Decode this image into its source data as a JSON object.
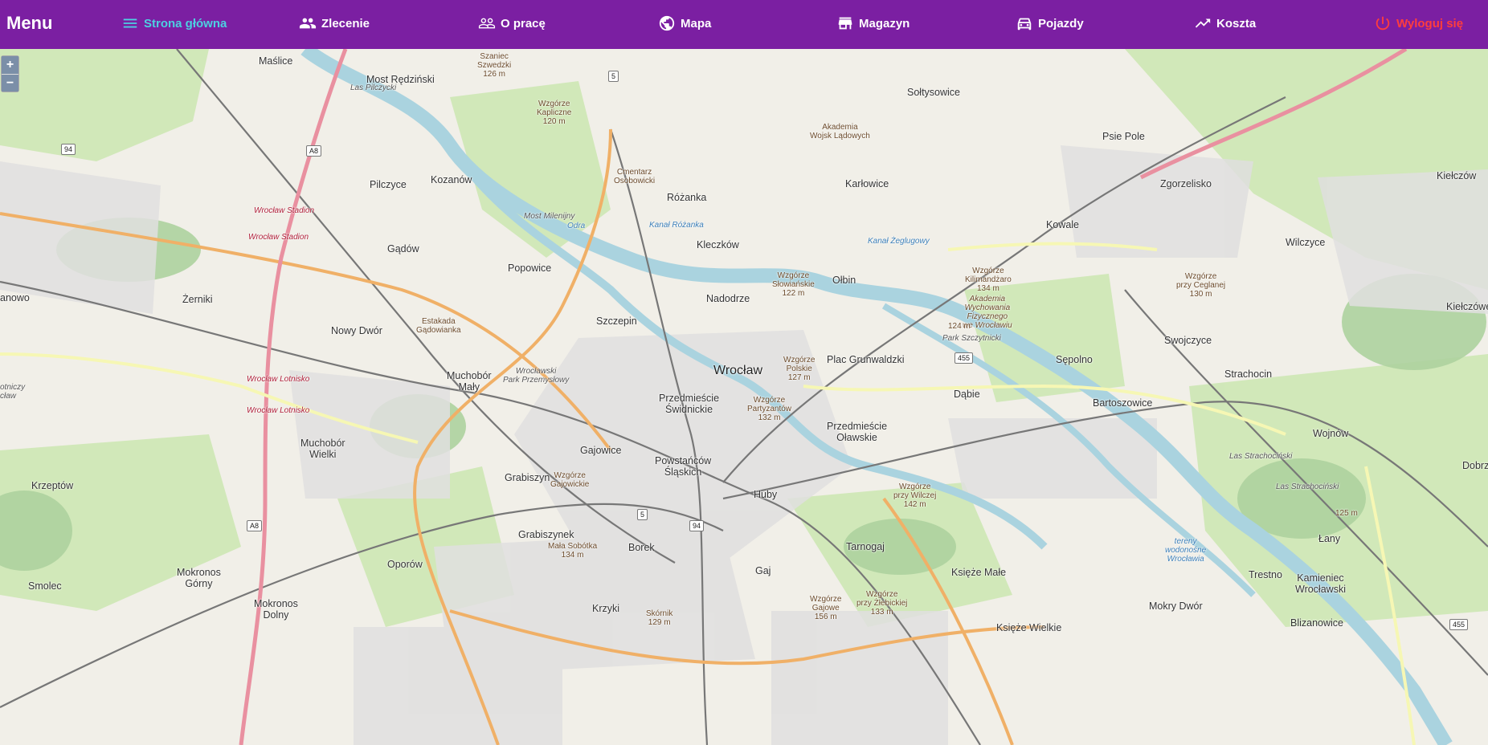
{
  "nav": {
    "brand": "Menu",
    "items": [
      {
        "label": "Strona główna",
        "icon": "menu-icon",
        "active": true
      },
      {
        "label": "Zlecenie",
        "icon": "people-icon"
      },
      {
        "label": "O pracę",
        "icon": "people-outline-icon"
      },
      {
        "label": "Mapa",
        "icon": "globe-icon"
      },
      {
        "label": "Magazyn",
        "icon": "store-icon"
      },
      {
        "label": "Pojazdy",
        "icon": "car-icon"
      },
      {
        "label": "Koszta",
        "icon": "trending-up-icon"
      },
      {
        "label": "Wyloguj się",
        "icon": "power-icon",
        "danger": true
      }
    ],
    "colors": {
      "bar": "#7b1fa2",
      "active": "#4dd0e1",
      "logout": "#ff3d3d"
    }
  },
  "map": {
    "zoom_in": "+",
    "zoom_out": "−",
    "labels": {
      "maslice": "Maślice",
      "most_redzinski": "Most Rędziński",
      "las_pilczycki": "Las Pilczycki",
      "szaniec": "Szaniec",
      "szwedzki": "Szwedzki",
      "h126": "126 m",
      "wz_kapliczne": "Wzgórze",
      "wz_kapliczne2": "Kapliczne",
      "h120": "120 m",
      "soltysowice": "Sołtysowice",
      "akademia": "Akademia",
      "wojsk": "Wojsk Lądowych",
      "psie_pole": "Psie Pole",
      "kielczow": "Kiełczów",
      "pilczyce": "Pilczyce",
      "kozanow": "Kozanów",
      "cmentarz": "Cmentarz",
      "osobowicki": "Osobowicki",
      "rozanka": "Różanka",
      "karlowice": "Karłowice",
      "zgorzelisko": "Zgorzelisko",
      "wroclaw_stadion": "Wrocław Stadion",
      "most_milenijny": "Most Milenijny",
      "kowale": "Kowale",
      "wilczyce": "Wilczyce",
      "gadow": "Gądów",
      "kleczkow": "Kleczków",
      "popowice": "Popowice",
      "wz_slowianskie": "Wzgórze",
      "wz_slowianskie2": "Słowiańskie",
      "h122": "122 m",
      "olbin": "Ołbin",
      "wz_kilimandzaro": "Wzgórze",
      "wz_kilimandzaro2": "Kilimandżaro",
      "h134": "134 m",
      "wz_ceglane": "Wzgórze",
      "wz_ceglane2": "przy Ceglanej",
      "h130": "130 m",
      "kielczowek": "Kiełczówek",
      "nanowo": "anowo",
      "zerniki": "Żerniki",
      "nadodrze": "Nadodrze",
      "akademia_wych": "Akademia",
      "akademia_wych2": "Wychowania",
      "akademia_wych3": "Fizycznego",
      "akademia_wych4": "we Wrocławiu",
      "nowy_dwor": "Nowy Dwór",
      "estakada": "Estakada",
      "gadowianka": "Gądowianka",
      "szczepin": "Szczepin",
      "h124": "124 m",
      "park_szczytnicki": "Park Szczytnicki",
      "swojczyce": "Swojczyce",
      "plac_grunwaldzki": "Plac Grunwaldzki",
      "sepolno": "Sępolno",
      "wroclaw": "Wrocław",
      "wz_polskie": "Wzgórze",
      "wz_polskie2": "Polskie",
      "h127": "127 m",
      "strachocin": "Strachocin",
      "muchobor_maly": "Muchobór",
      "muchobor_maly2": "Mały",
      "wroclawski_park": "Wrocławski",
      "wroclawski_park2": "Park Przemysłowy",
      "dabie": "Dąbie",
      "wroclaw_lotnisko": "Wrocław Lotnisko",
      "przedmiescie_sw": "Przedmieście",
      "przedmiescie_sw2": "Świdnickie",
      "wz_partyzantow": "Wzgórze",
      "wz_partyzantow2": "Partyzantów",
      "h132": "132 m",
      "bartoszowice": "Bartoszowice",
      "lotniczy": "otniczy",
      "wlaw": "cław",
      "przedmiescie_ol": "Przedmieście",
      "przedmiescie_ol2": "Oławskie",
      "wojnow": "Wojnów",
      "muchobor_wielki": "Muchobór",
      "muchobor_wielki2": "Wielki",
      "gajowice": "Gajowice",
      "las_strachocinski": "Las Strachociński",
      "dobrzykowice": "Dobrzyk",
      "krzeptow": "Krzeptów",
      "grabiszyn": "Grabiszyn",
      "wz_gajowickie": "Wzgórze",
      "wz_gajowickie2": "Gajowickie",
      "powstancow": "Powstańców",
      "powstancow2": "Śląskich",
      "huby": "Huby",
      "wz_wilczej": "Wzgórze",
      "wz_wilczej2": "przy Wilczej",
      "h142": "142 m",
      "h125": "125 m",
      "lany": "Łany",
      "tereny": "tereny",
      "tereny2": "wodonośne",
      "tereny3": "Wrocławia",
      "grabiszynek": "Grabiszynek",
      "mala_sobotka": "Mała Sobótka",
      "h134b": "134 m",
      "borek": "Borek",
      "tarnogaj": "Tarnogaj",
      "mokronos_gorny": "Mokronos",
      "mokronos_gorny2": "Górny",
      "oporow": "Oporów",
      "gaj": "Gaj",
      "ksieze_male": "Księże Małe",
      "trestno": "Trestno",
      "kamieniec": "Kamieniec",
      "kamieniec2": "Wrocławski",
      "smolec": "Smolec",
      "mokronos_dolny": "Mokronos",
      "mokronos_dolny2": "Dolny",
      "krzyki": "Krzyki",
      "skornik": "Skórnik",
      "h129": "129 m",
      "wz_gajowe": "Wzgórze",
      "wz_gajowe2": "Gajowe",
      "h156": "156 m",
      "wz_zlebickiej": "Wzgórze",
      "wz_zlebickiej2": "przy Żłebickiej",
      "h133": "133 m",
      "mokry_dwor": "Mokry Dwór",
      "blizanowice": "Blizanowice",
      "ksieze_wielkie": "Księże Wielkie",
      "odra": "Odra",
      "kanal_zeglugowy": "Kanał Żeglugowy",
      "kanal_rozanka": "Kanał Różanka"
    },
    "shields": [
      "5",
      "94",
      "A8",
      "A8",
      "455",
      "5",
      "94",
      "455"
    ]
  }
}
